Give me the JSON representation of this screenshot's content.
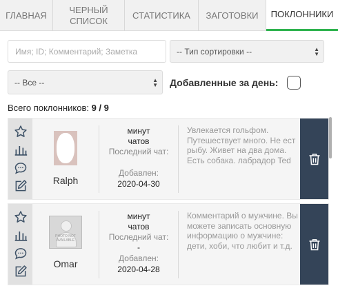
{
  "tabs": [
    {
      "label": "ГЛАВНАЯ"
    },
    {
      "label": "ЧЕРНЫЙ СПИСОК"
    },
    {
      "label": "СТАТИСТИКА"
    },
    {
      "label": "ЗАГОТОВКИ"
    },
    {
      "label": "ПОКЛОННИКИ"
    }
  ],
  "active_tab": "ПОКЛОННИКИ",
  "filters": {
    "search_placeholder": "Имя; ID; Комментарий; Заметка",
    "sort_select": "-- Тип сортировки --",
    "all_select": "-- Все --",
    "added_today_label": "Добавленные за день:"
  },
  "total": {
    "label": "Всего поклонников:",
    "value": "9 / 9"
  },
  "fans": [
    {
      "name": "Ralph",
      "time_value": "минут",
      "time_unit": "чатов",
      "last_chat_label": "Последний чат:",
      "last_chat_value": "",
      "added_label": "Добавлен:",
      "added_value": "2020-04-30",
      "comment": "Увлекается гольфом. Путешествует много. Не ест рыбу. Живет на два дома. Есть собака. лабрадор Ted"
    },
    {
      "name": "Omar",
      "time_value": "минут",
      "time_unit": "чатов",
      "last_chat_label": "Последний чат:",
      "last_chat_value": "-",
      "added_label": "Добавлен:",
      "added_value": "2020-04-28",
      "comment": "Комментарий о мужчине. Вы можете записать основную информацию о мужчине: дети, хоби, что любит и т.д.",
      "photo_text": "PHOTO NOT AVAILABLE"
    }
  ],
  "colors": {
    "accent": "#2fb34f",
    "trash_bg": "#344458"
  }
}
